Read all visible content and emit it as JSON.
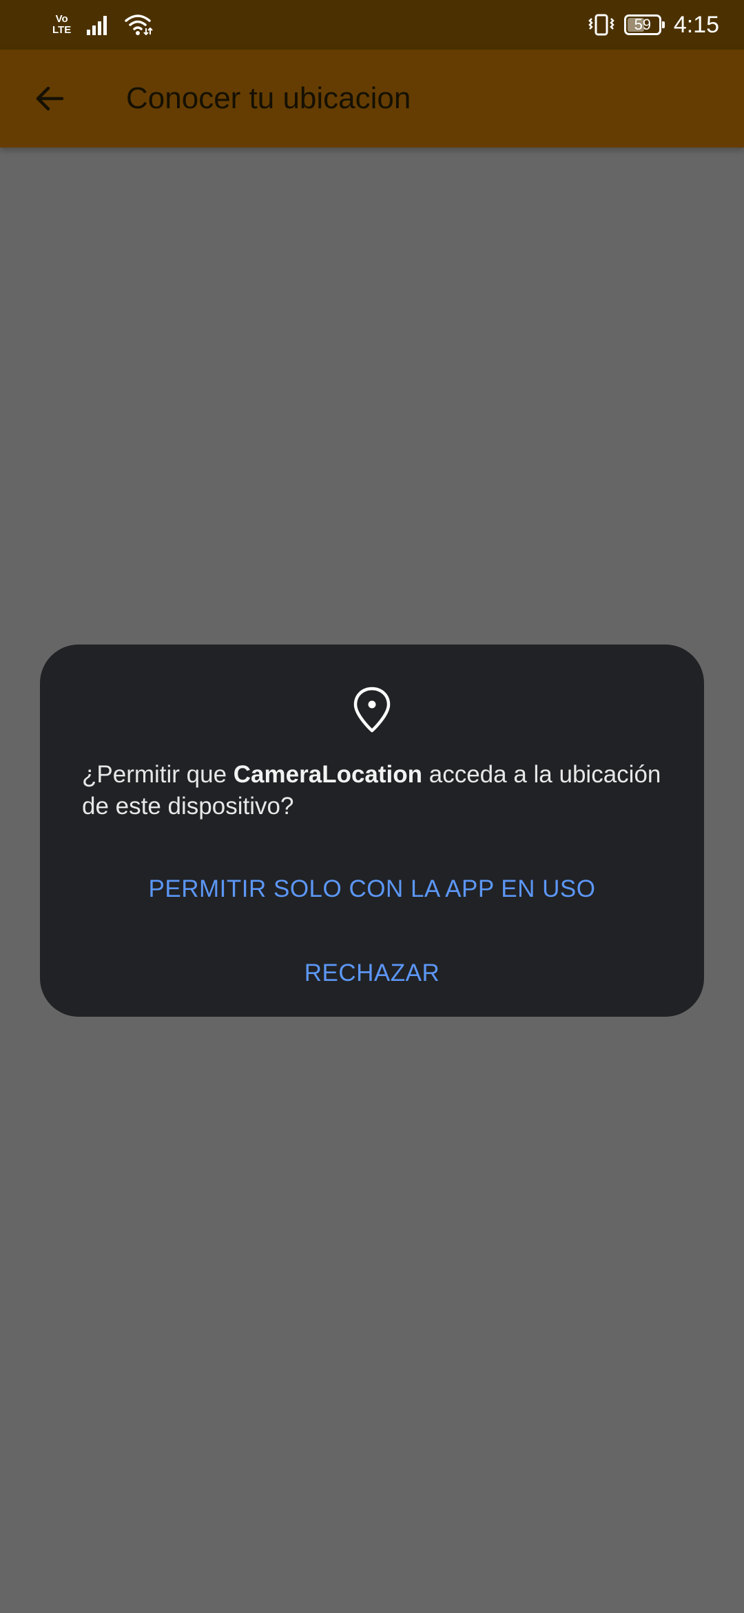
{
  "status_bar": {
    "volte_top": "Vo",
    "volte_bottom": "LTE",
    "signal_icon": "cell-signal-icon",
    "wifi_icon": "wifi-icon",
    "vibrate_icon": "vibrate-icon",
    "battery_level": "59",
    "battery_fraction": 0.59,
    "time": "4:15"
  },
  "app_bar": {
    "back_icon": "arrow-back-icon",
    "title": "Conocer tu ubicacion"
  },
  "dialog": {
    "icon": "location-pin-icon",
    "message_prefix": "¿Permitir que ",
    "app_name": "CameraLocation",
    "message_suffix": " acceda a la ubicación de este dispositivo?",
    "allow_label": "PERMITIR SOLO CON LA APP EN USO",
    "deny_label": "RECHAZAR"
  },
  "colors": {
    "status_bar_bg": "#4b3101",
    "app_bar_bg": "#653d02",
    "scrim": "#666666",
    "dialog_bg": "#212225",
    "accent_blue": "#5c97f6"
  }
}
